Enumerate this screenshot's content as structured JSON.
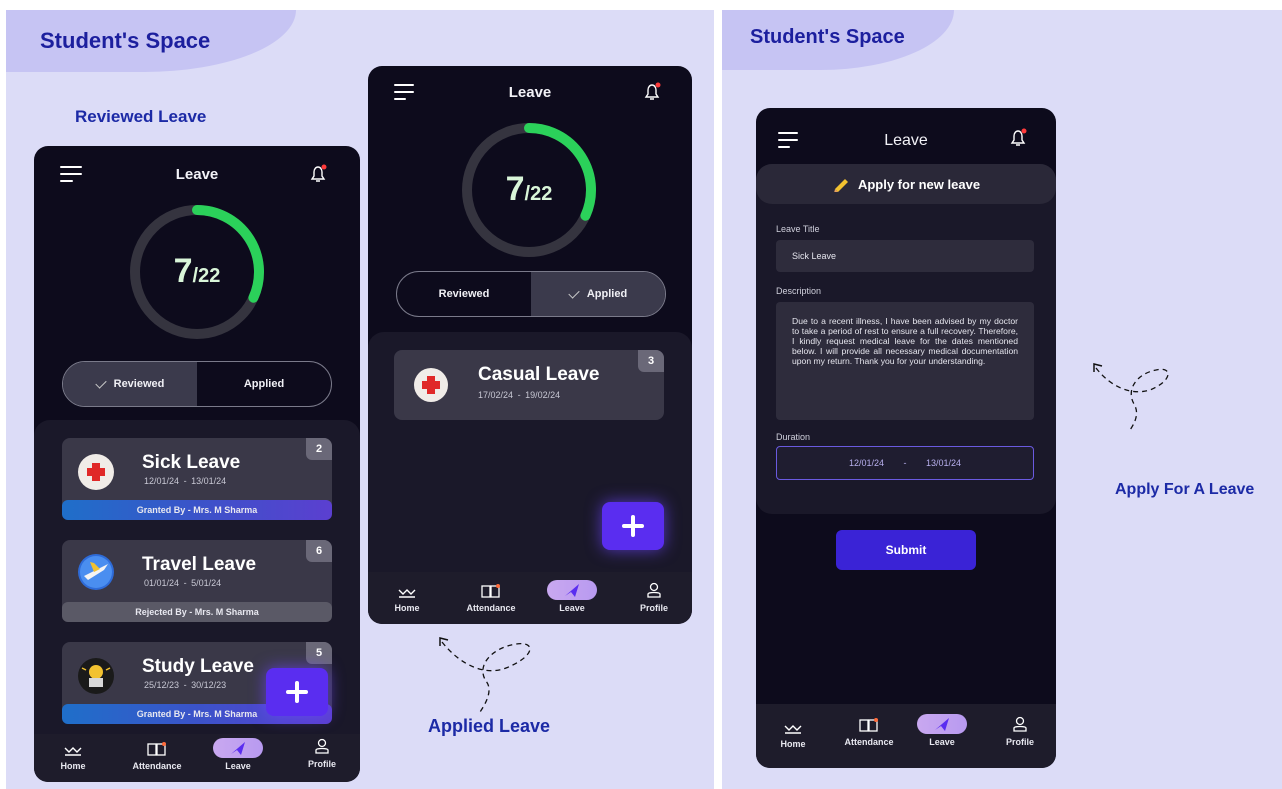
{
  "brand": "Student's Space",
  "captions": {
    "reviewed": "Reviewed Leave",
    "applied": "Applied Leave",
    "apply": "Apply For A Leave"
  },
  "header_title": "Leave",
  "counter": {
    "used": "7",
    "total": "/22",
    "fraction": 0.318
  },
  "segment": {
    "reviewed": "Reviewed",
    "applied": "Applied"
  },
  "reviewed_cards": [
    {
      "title": "Sick Leave",
      "from": "12/01/24",
      "to": "13/01/24",
      "count": "2",
      "status": "Granted By - Mrs. M Sharma"
    },
    {
      "title": "Travel Leave",
      "from": "01/01/24",
      "to": "5/01/24",
      "count": "6",
      "status": "Rejected By - Mrs. M Sharma"
    },
    {
      "title": "Study Leave",
      "from": "25/12/23",
      "to": "30/12/23",
      "count": "5",
      "status": "Granted By - Mrs. M Sharma"
    }
  ],
  "applied_cards": [
    {
      "title": "Casual Leave",
      "from": "17/02/24",
      "to": "19/02/24",
      "count": "3"
    }
  ],
  "nav": {
    "home": "Home",
    "attendance": "Attendance",
    "leave": "Leave",
    "profile": "Profile"
  },
  "form": {
    "heading": "Apply for new leave",
    "title_label": "Leave Title",
    "title_value": "Sick Leave",
    "desc_label": "Description",
    "desc_value": "Due to a recent illness, I have been advised by my doctor to take a period of rest to ensure a full recovery. Therefore, I kindly request medical leave for the dates mentioned below. I will provide all necessary medical documentation upon my return. Thank you for your understanding.",
    "duration_label": "Duration",
    "duration_from": "12/01/24",
    "duration_to": "13/01/24",
    "submit": "Submit"
  },
  "date_separator": "-",
  "colors": {
    "accent": "#5a2df0",
    "ring": "#2bd15a",
    "brand": "#1c1f9e"
  }
}
